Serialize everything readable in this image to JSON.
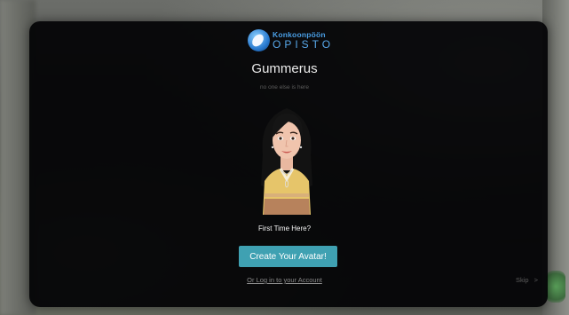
{
  "logo": {
    "line1": "Konkoonpöön",
    "line2": "OPISTO"
  },
  "title": "Gummerus",
  "subtitle": "no one else is here",
  "prompt": "First Time Here?",
  "create_avatar_label": "Create Your Avatar!",
  "login_label": "Or Log in to your Account",
  "skip_label": "Skip",
  "skip_icon": ">",
  "colors": {
    "button": "#3fa1b2",
    "logo_blue": "#4a9fe6",
    "panel": "#020204"
  }
}
